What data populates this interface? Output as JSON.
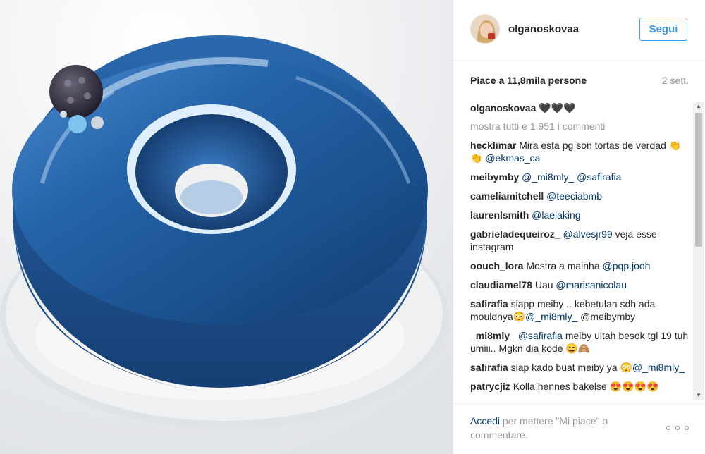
{
  "post": {
    "image_alt": "",
    "username": "olganoskovaa",
    "follow_label": "Segui",
    "likes_text": "Piace a 11,8mila persone",
    "time_ago": "2 sett.",
    "caption": {
      "author": "olganoskovaa",
      "text": " 🖤🖤🖤"
    },
    "load_more": "mostra tutti e 1.951 i commenti",
    "comments": [
      {
        "author": "hecklimar",
        "text": " Mira esta pg son tortas de verdad 👏👏 ",
        "mention": "@ekmas_ca",
        "after": ""
      },
      {
        "author": "meibymby",
        "text": " ",
        "mention": "@_mi8mly_ @safirafia",
        "after": ""
      },
      {
        "author": "cameliamitchell",
        "text": " ",
        "mention": "@teeciabmb",
        "after": ""
      },
      {
        "author": "laurenlsmith",
        "text": " ",
        "mention": "@laelaking",
        "after": ""
      },
      {
        "author": "gabrieladequeiroz_",
        "text": " ",
        "mention": "@alvesjr99",
        "after": " veja esse instagram"
      },
      {
        "author": "oouch_lora",
        "text": " Mostra a mainha ",
        "mention": "@pqp.jooh",
        "after": ""
      },
      {
        "author": "claudiamel78",
        "text": " Uau ",
        "mention": "@marisanicolau",
        "after": ""
      },
      {
        "author": "safirafia",
        "text": " siapp meiby .. kebetulan sdh ada mouldnya😳",
        "mention": "@_mi8mly_",
        "after": " @meibymby"
      },
      {
        "author": "_mi8mly_",
        "text": " ",
        "mention": "@safirafia",
        "after": " meiby ultah besok tgl 19 tuh umiii.. Mgkn dia kode 😄🙈"
      },
      {
        "author": "safirafia",
        "text": " siap kado buat meiby ya 😳",
        "mention": "@_mi8mly_",
        "after": ""
      },
      {
        "author": "patrycjiz",
        "text": " Kolla hennes bakelse 😍😍😍😍",
        "mention": "",
        "after": ""
      }
    ],
    "footer": {
      "login_link": "Accedi",
      "login_text": " per mettere \"Mi piace\" o commentare."
    }
  },
  "icons": {
    "more": "more-options-icon",
    "scroll_up": "scroll-up-arrow-icon",
    "scroll_down": "scroll-down-arrow-icon"
  },
  "colors": {
    "link": "#003569",
    "follow": "#3897f0",
    "muted": "#999999",
    "glaze": "#1f5d9c"
  }
}
